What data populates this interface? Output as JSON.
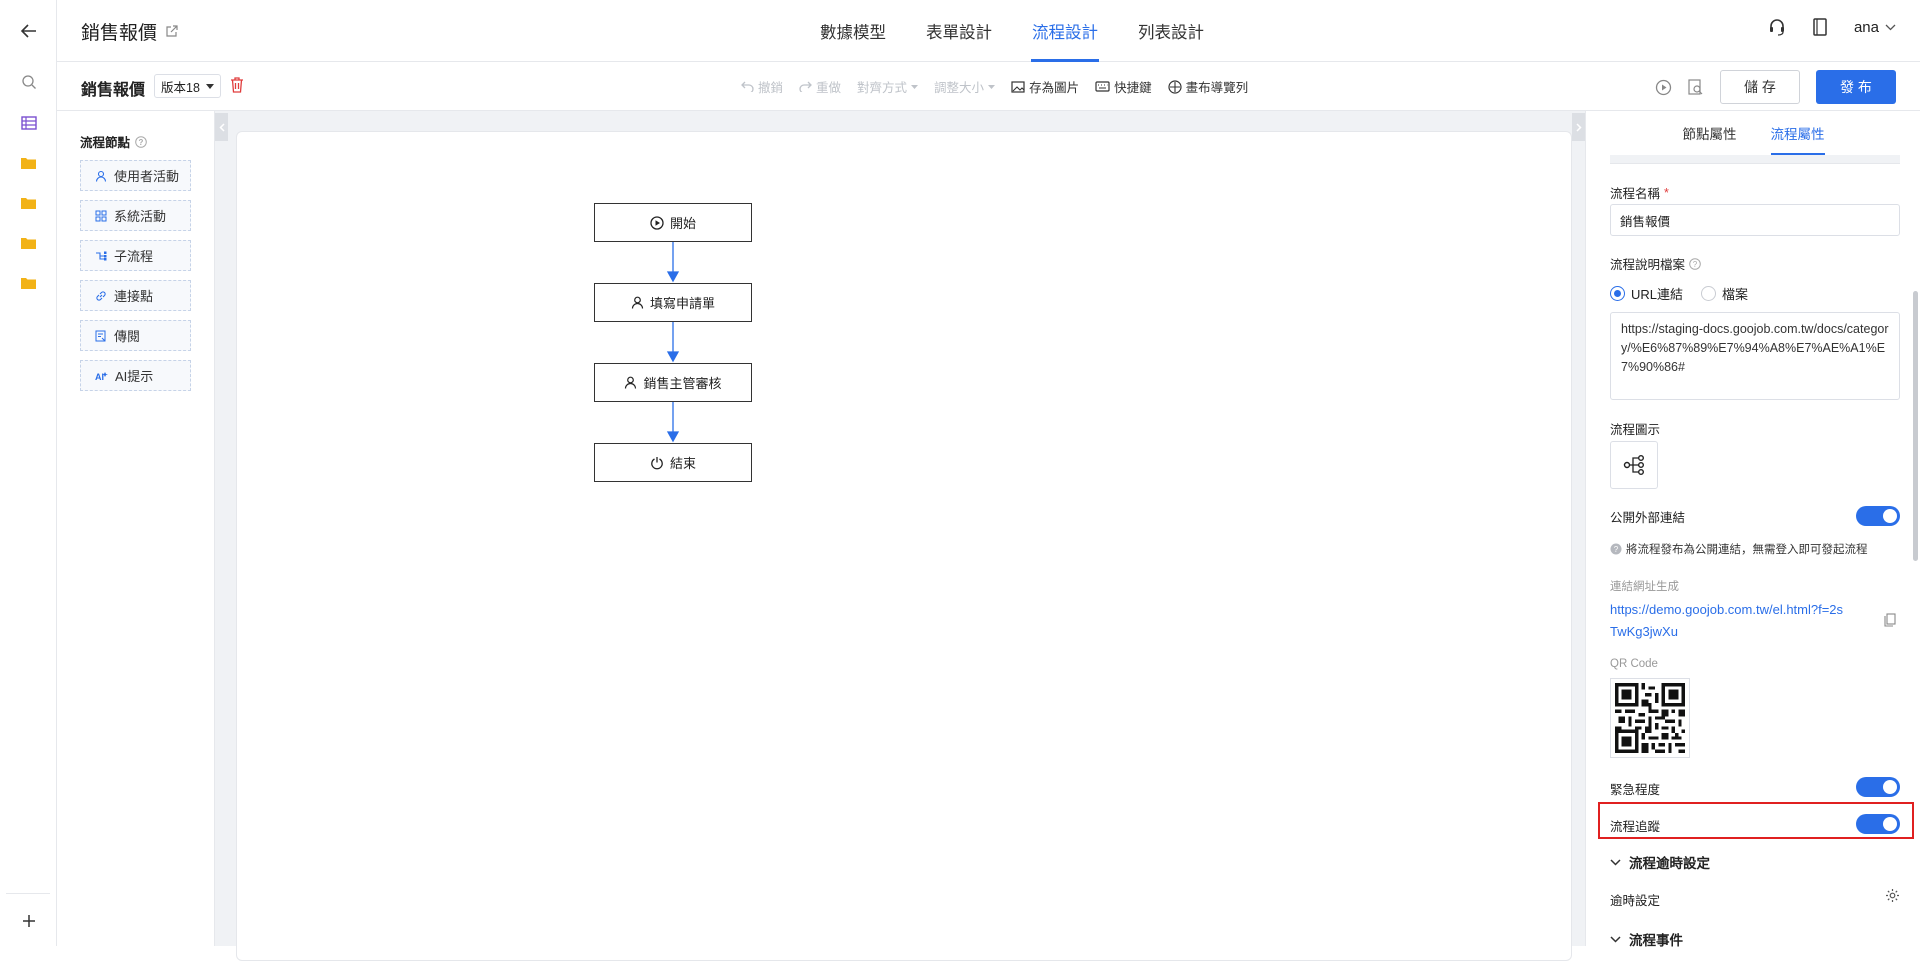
{
  "header": {
    "app_title": "銷售報價",
    "tabs": [
      {
        "label": "數據模型",
        "active": false
      },
      {
        "label": "表單設計",
        "active": false
      },
      {
        "label": "流程設計",
        "active": true
      },
      {
        "label": "列表設計",
        "active": false
      }
    ],
    "user": "ana"
  },
  "toolbar": {
    "flow_name": "銷售報價",
    "version": "版本18",
    "tools": [
      {
        "label": "撤銷",
        "icon": "undo-icon",
        "enabled": false
      },
      {
        "label": "重做",
        "icon": "redo-icon",
        "enabled": false
      },
      {
        "label": "對齊方式",
        "icon": "",
        "enabled": false
      },
      {
        "label": "調整大小",
        "icon": "",
        "enabled": false
      },
      {
        "label": "存為圖片",
        "icon": "image-icon",
        "enabled": true
      },
      {
        "label": "快捷鍵",
        "icon": "keyboard-icon",
        "enabled": true
      },
      {
        "label": "畫布導覽列",
        "icon": "compass-icon",
        "enabled": true
      }
    ],
    "save_label": "儲 存",
    "publish_label": "發 布"
  },
  "palette": {
    "title": "流程節點",
    "items": [
      {
        "label": "使用者活動",
        "icon": "user-icon"
      },
      {
        "label": "系統活動",
        "icon": "grid-icon"
      },
      {
        "label": "子流程",
        "icon": "subflow-icon"
      },
      {
        "label": "連接點",
        "icon": "link-icon"
      },
      {
        "label": "傳閱",
        "icon": "circulate-icon"
      },
      {
        "label": "AI提示",
        "icon": "ai-icon"
      }
    ]
  },
  "flow": {
    "nodes": [
      {
        "label": "開始",
        "icon": "play-icon"
      },
      {
        "label": "填寫申請單",
        "icon": "user-icon"
      },
      {
        "label": "銷售主管審核",
        "icon": "user-icon"
      },
      {
        "label": "結束",
        "icon": "power-icon"
      }
    ]
  },
  "panel": {
    "tabs": [
      {
        "label": "節點屬性",
        "active": false
      },
      {
        "label": "流程屬性",
        "active": true
      }
    ],
    "flow_name_label": "流程名稱",
    "flow_name_required": "*",
    "flow_name_value": "銷售報價",
    "doc_label": "流程說明檔案",
    "doc_options": [
      {
        "label": "URL連結",
        "selected": true
      },
      {
        "label": "檔案",
        "selected": false
      }
    ],
    "doc_url": "https://staging-docs.goojob.com.tw/docs/category/%E6%87%89%E7%94%A8%E7%AE%A1%E7%90%86#",
    "flow_icon_label": "流程圖示",
    "public_link_label": "公開外部連結",
    "public_link_on": true,
    "public_link_hint": "將流程發布為公開連結，無需登入即可發起流程",
    "link_gen_label": "連結網址生成",
    "public_url": "https://demo.goojob.com.tw/el.html?f=2sTwKg3jwXu",
    "qr_label": "QR Code",
    "urgency_label": "緊急程度",
    "urgency_on": true,
    "tracking_label": "流程追蹤",
    "tracking_on": true,
    "timeout_section": "流程逾時設定",
    "timeout_setting_label": "逾時設定",
    "events_section": "流程事件"
  },
  "colors": {
    "accent": "#2a6ee8",
    "highlight": "#e02020",
    "folder": "#f2b216"
  }
}
